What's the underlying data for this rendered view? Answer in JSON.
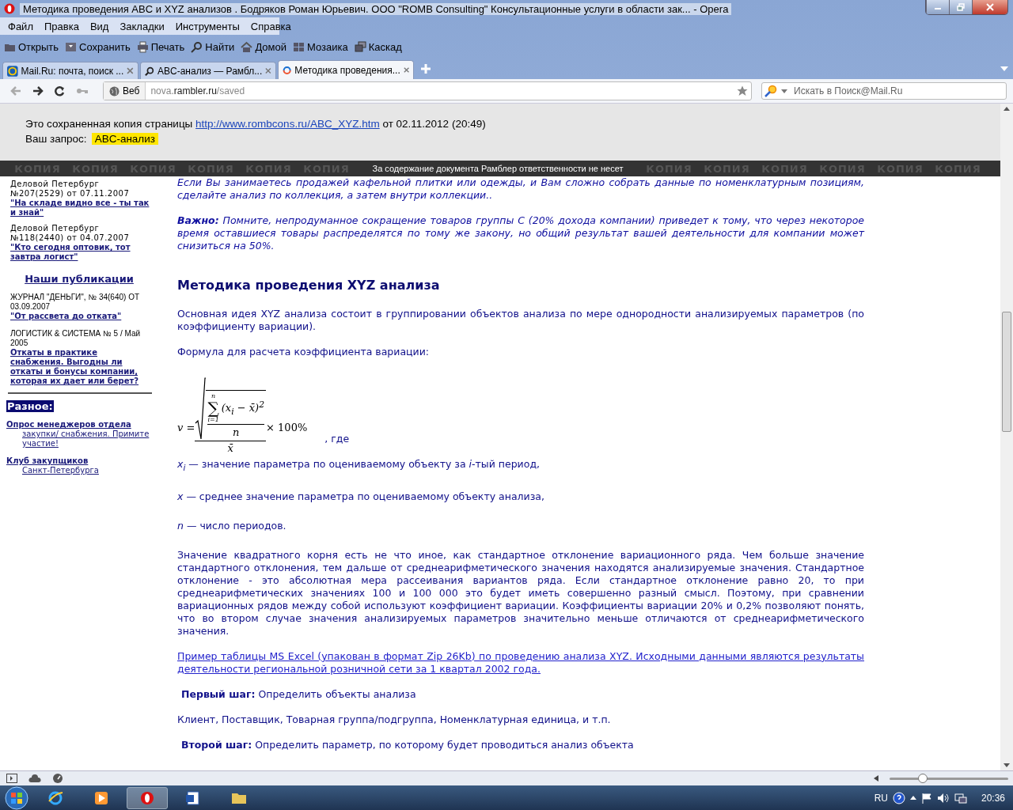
{
  "window": {
    "title": "Методика проведения ABC и XYZ анализов . Бодряков Роман Юрьевич. ООО \"ROMB Consulting\" Консультационные услуги в области зак... - Opera"
  },
  "menu": [
    "Файл",
    "Правка",
    "Вид",
    "Закладки",
    "Инструменты",
    "Справка"
  ],
  "toolbar": [
    {
      "kind": "open",
      "label": "Открыть"
    },
    {
      "kind": "save",
      "label": "Сохранить"
    },
    {
      "kind": "print",
      "label": "Печать"
    },
    {
      "kind": "find",
      "label": "Найти"
    },
    {
      "kind": "home",
      "label": "Домой"
    },
    {
      "kind": "tile",
      "label": "Мозаика"
    },
    {
      "kind": "cascade",
      "label": "Каскад"
    }
  ],
  "tabs": [
    {
      "kind": "mail",
      "label": "Mail.Ru: почта, поиск ...",
      "selected": false
    },
    {
      "kind": "search",
      "label": "ABC-анализ — Рамбл...",
      "selected": false
    },
    {
      "kind": "rambler",
      "label": "Методика проведения...",
      "selected": true
    }
  ],
  "nav": [
    {
      "kind": "back",
      "disabled": true
    },
    {
      "kind": "forward",
      "disabled": false
    },
    {
      "kind": "reload",
      "disabled": false
    },
    {
      "kind": "key",
      "disabled": true
    }
  ],
  "address": {
    "scope": "Веб",
    "pre": "nova.",
    "host": "rambler.ru",
    "path": "/saved"
  },
  "search": {
    "placeholder": "Искать в Поиск@Mail.Ru"
  },
  "saved_note": {
    "before": "Это сохраненная копия страницы ",
    "link": "http://www.rombcons.ru/ABC_XYZ.htm",
    "after": " от 02.11.2012 (20:49)"
  },
  "query": {
    "label": "Ваш запрос:",
    "value": "ABC-анализ"
  },
  "strip": {
    "marks_left": [
      "КОПИЯ",
      "КОПИЯ",
      "КОПИЯ",
      "КОПИЯ",
      "КОПИЯ",
      "КОПИЯ"
    ],
    "notice": "За содержание документа Рамблер ответственности не несет",
    "marks_right": [
      "КОПИЯ",
      "КОПИЯ",
      "КОПИЯ",
      "КОПИЯ",
      "КОПИЯ",
      "КОПИЯ"
    ]
  },
  "sidebar": [
    {
      "kind": "source",
      "text": "Деловой Петербург №207(2529) от 07.11.2007"
    },
    {
      "kind": "link",
      "text": "\"На складе видно все - ты так и знай\""
    },
    {
      "kind": "source",
      "text": "Деловой Петербург №118(2440) от 04.07.2007"
    },
    {
      "kind": "link",
      "text": "\"Кто сегодня оптовик, тот завтра логист\""
    },
    {
      "kind": "heading",
      "text": "Наши публикации"
    },
    {
      "kind": "source2",
      "text": "ЖУРНАЛ \"ДЕНЬГИ\", № 34(640) ОТ 03.09.2007"
    },
    {
      "kind": "link",
      "text": "\"От рассвета до отката\""
    },
    {
      "kind": "source2",
      "text": "ЛОГИСТИК & СИСТЕМА № 5 / Май 2005"
    },
    {
      "kind": "link",
      "text": "Откаты в практике снабжения. Выгодны ли откаты и бонусы компании, которая их дает или берет?"
    },
    {
      "kind": "rule"
    },
    {
      "kind": "badge",
      "text": "Разное:"
    },
    {
      "kind": "hanging",
      "text": "Опрос менеджеров отдела",
      "rest": "закупки/ снабжения. Примите участие!"
    },
    {
      "kind": "hanging",
      "text": "Клуб закупщиков",
      "rest": "Санкт-Петербурга"
    }
  ],
  "content": [
    {
      "kind": "italic",
      "text": "Если Вы занимаетесь продажей кафельной плитки или одежды, и Вам сложно собрать данные по номенклатурным позициям, сделайте анализ по коллекция, а затем внутри коллекции.."
    },
    {
      "kind": "italic",
      "text": "**Важно:** Помните, непродуманное сокращение товаров группы С (20% дохода компании) приведет к тому, что через некоторое время оставшиеся товары распределятся по тому же закону, но общий результат  вашей деятельности для компании может  снизиться на 50%."
    },
    {
      "kind": "heading",
      "text": "Методика проведения XYZ анализа"
    },
    {
      "kind": "text",
      "text": "Основная идея XYZ анализа состоит в группировании объектов анализа по мере однородности анализируемых параметров (по коэффициенту вариации)."
    },
    {
      "kind": "text",
      "text": "Формула для расчета коэффициента вариации:"
    },
    {
      "kind": "formula",
      "lhs": "v =",
      "sum_top": "n",
      "sum": "∑",
      "sum_bottom": "i=1",
      "term": "(x$_{i}$ − x̄)$^{2}$",
      "inner_den": "n",
      "outer_den": "x̄",
      "suffix": "× 100%",
      "note": ", где"
    },
    {
      "kind": "definition",
      "text": "*x*$_{i}$ — значение параметра по оцениваемому объекту за *i*-тый период,"
    },
    {
      "kind": "definition",
      "text": "*x*  — среднее значение параметра по оцениваемому объекту анализа,"
    },
    {
      "kind": "definition",
      "text": "*n*  — число периодов."
    },
    {
      "kind": "text",
      "text": "Значение квадратного корня есть не что иное, как стандартное отклонение вариационного ряда. Чем больше значение стандартного отклонения, тем дальше от среднеарифметического значения находятся анализируемые значения. Стандартное отклонение - это абсолютная мера рассеивания вариантов ряда. Если стандартное отклонение равно 20, то при среднеарифметических значениях 100 и 100 000 это будет иметь совершенно разный смысл. Поэтому, при сравнении вариационных рядов между собой используют  коэффициент вариации.  Коэффициенты вариации 20% и 0,2% позволяют понять, что во втором случае значения анализируемых параметров значительно меньше отличаются от среднеарифметического значения."
    },
    {
      "kind": "link",
      "text": "Пример таблицы MS Excel (упакован в формат Zip 26Kb) по проведению анализа XYZ. Исходными данными являются результаты деятельности региональной розничной сети за 1 квартал 2002 года."
    },
    {
      "kind": "step",
      "text": "**Первый шаг:** Определить объекты анализа"
    },
    {
      "kind": "text",
      "text": "Клиент, Поставщик, Товарная группа/подгруппа, Номенклатурная единица, и т.п."
    },
    {
      "kind": "step",
      "text": "**Второй шаг:** Определить параметр, по которому будет проводиться анализ объекта"
    }
  ],
  "zoom": {
    "level": 0.28
  },
  "taskbar": {
    "apps": [
      {
        "kind": "ie",
        "selected": false
      },
      {
        "kind": "media",
        "selected": false
      },
      {
        "kind": "opera",
        "selected": true
      },
      {
        "kind": "word",
        "selected": false
      },
      {
        "kind": "folder",
        "selected": false
      }
    ],
    "lang": "RU",
    "clock": "20:36"
  }
}
